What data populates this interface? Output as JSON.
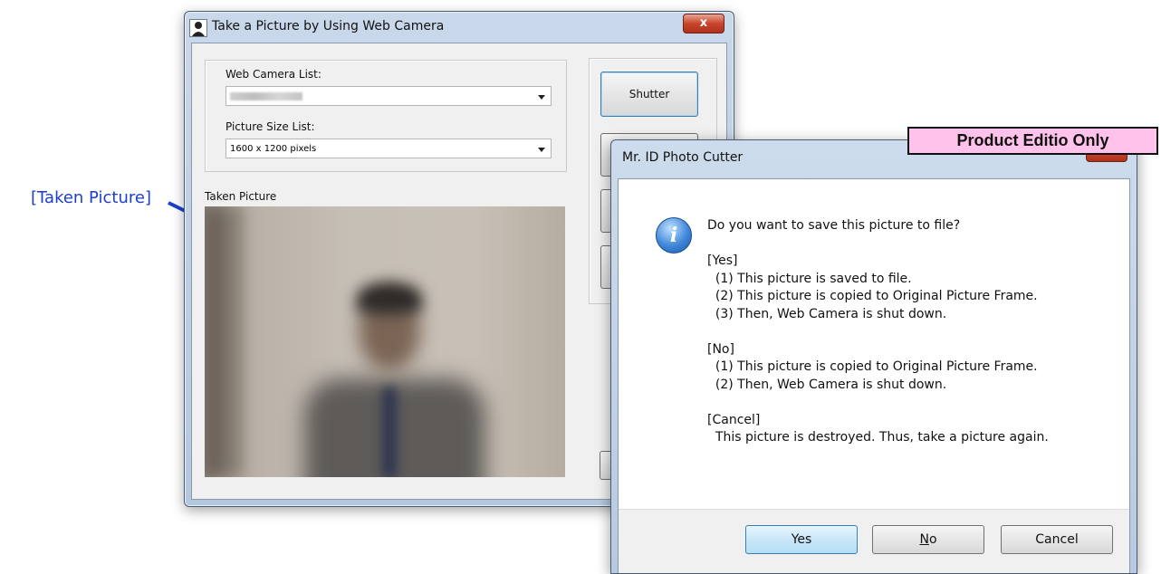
{
  "callout": {
    "text": "[Taken Picture]"
  },
  "main_window": {
    "title": "Take a Picture by Using Web Camera",
    "close_label": "x",
    "camera_list_label": "Web Camera List:",
    "picture_size_label": "Picture Size List:",
    "picture_size_value": "1600 x 1200 pixels",
    "taken_picture_label": "Taken Picture",
    "shutter_label": "Shutter"
  },
  "dialog": {
    "title": "Mr. ID Photo Cutter",
    "badge": "Product Editio Only",
    "icon": "info-icon",
    "message": "Do you want to save this picture to file?\n\n[Yes]\n  (1) This picture is saved to file.\n  (2) This picture is copied to Original Picture Frame.\n  (3) Then, Web Camera is shut down.\n\n[No]\n  (1) This picture is copied to Original Picture Frame.\n  (2) Then, Web Camera is shut down.\n\n[Cancel]\n  This picture is destroyed. Thus, take a picture again.",
    "buttons": {
      "yes": "Yes",
      "no_mnemonic": "N",
      "no_rest": "o",
      "cancel": "Cancel"
    }
  },
  "colors": {
    "callout": "#1a3fd1",
    "badge": "#ffc2ea",
    "close": "#c8452c"
  }
}
